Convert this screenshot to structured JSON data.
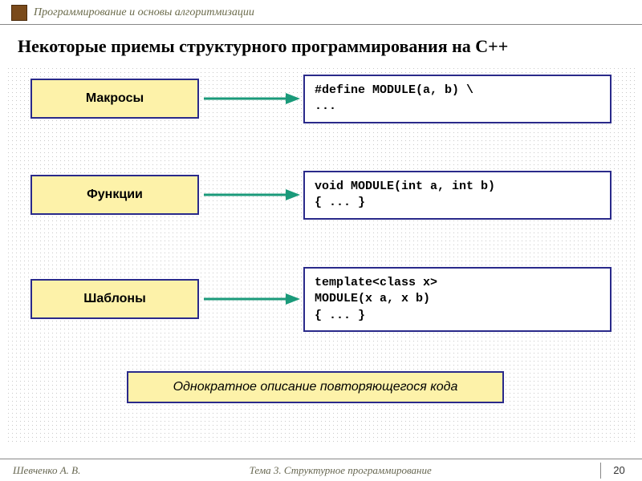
{
  "header": {
    "course": "Программирование и основы алгоритмизации"
  },
  "title": "Некоторые приемы структурного программирования на С++",
  "rows": [
    {
      "label": "Макросы",
      "code": "#define MODULE(a, b) \\\n..."
    },
    {
      "label": "Функции",
      "code": "void MODULE(int a, int b)\n{ ... }"
    },
    {
      "label": "Шаблоны",
      "code": "template<class x>\nMODULE(x a, x b)\n{ ... }"
    }
  ],
  "caption": "Однократное описание повторяющегося кода",
  "footer": {
    "author": "Шевченко А. В.",
    "topic": "Тема 3. Структурное программирование",
    "page": "20"
  },
  "colors": {
    "box_fill": "#fdf2a9",
    "box_border": "#2a2a8a",
    "arrow": "#1a9a7a"
  }
}
